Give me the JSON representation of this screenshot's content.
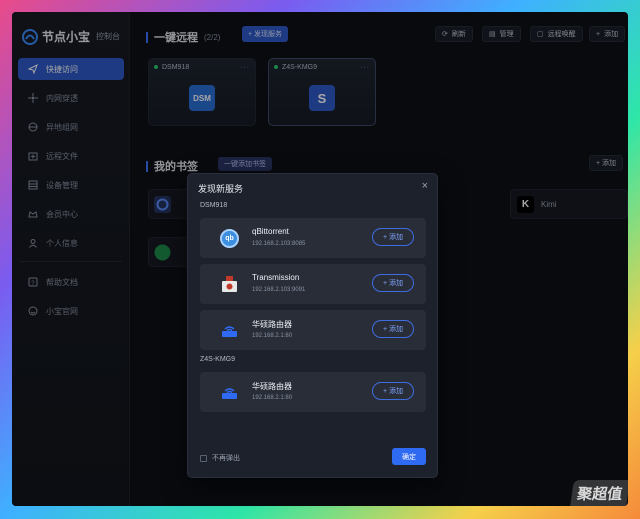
{
  "brand": {
    "name": "节点小宝",
    "sub": "控制台"
  },
  "sidebar": {
    "items": [
      {
        "label": "快捷访问",
        "icon": "send-icon",
        "active": true
      },
      {
        "label": "内网穿透",
        "icon": "network-icon"
      },
      {
        "label": "异地组网",
        "icon": "globe-icon"
      },
      {
        "label": "远程文件",
        "icon": "folder-icon"
      },
      {
        "label": "设备管理",
        "icon": "device-icon"
      },
      {
        "label": "会员中心",
        "icon": "crown-icon"
      },
      {
        "label": "个人信息",
        "icon": "user-icon"
      }
    ],
    "items2": [
      {
        "label": "帮助文档",
        "icon": "help-icon"
      },
      {
        "label": "小宝官网",
        "icon": "smile-icon"
      }
    ]
  },
  "remote": {
    "title": "一键远程",
    "count": "(2/2)",
    "discover_label": "+ 发现服务",
    "toolbar": [
      {
        "label": "刷新",
        "icon": "refresh-icon"
      },
      {
        "label": "管理",
        "icon": "manage-icon"
      },
      {
        "label": "远程唤醒",
        "icon": "wake-icon"
      },
      {
        "label": "添加",
        "icon": "plus-icon"
      }
    ],
    "devices": [
      {
        "name": "DSM918",
        "more": "···",
        "icon_text": "DSM"
      },
      {
        "name": "Z4S-KMG9",
        "more": "···",
        "icon_text": "S"
      }
    ]
  },
  "bookmarks": {
    "title": "我的书签",
    "quick_add_label": "一键添加书签",
    "add_label": "+ 添加",
    "visible": [
      {
        "label": "Kimi",
        "icon_text": "K"
      }
    ]
  },
  "modal": {
    "title": "发现新服务",
    "close": "×",
    "groups": [
      {
        "label": "DSM918",
        "services": [
          {
            "name": "qBittorrent",
            "ip": "192.168.2.103:8085",
            "icon_text": "qb",
            "add": "+ 添加"
          },
          {
            "name": "Transmission",
            "ip": "192.168.2.103:9091",
            "icon_text": "",
            "add": "+ 添加"
          },
          {
            "name": "华硕路由器",
            "ip": "192.168.2.1:80",
            "icon_text": "",
            "add": "+ 添加"
          }
        ]
      },
      {
        "label": "Z4S-KMG9",
        "services": [
          {
            "name": "华硕路由器",
            "ip": "192.168.2.1:80",
            "icon_text": "",
            "add": "+ 添加"
          }
        ]
      }
    ],
    "dont_show": "不再弹出",
    "confirm": "确定"
  },
  "watermark": "聚超值",
  "colors": {
    "accent": "#2f59c9",
    "confirm": "#2f6bf2",
    "online": "#2ecc71"
  }
}
